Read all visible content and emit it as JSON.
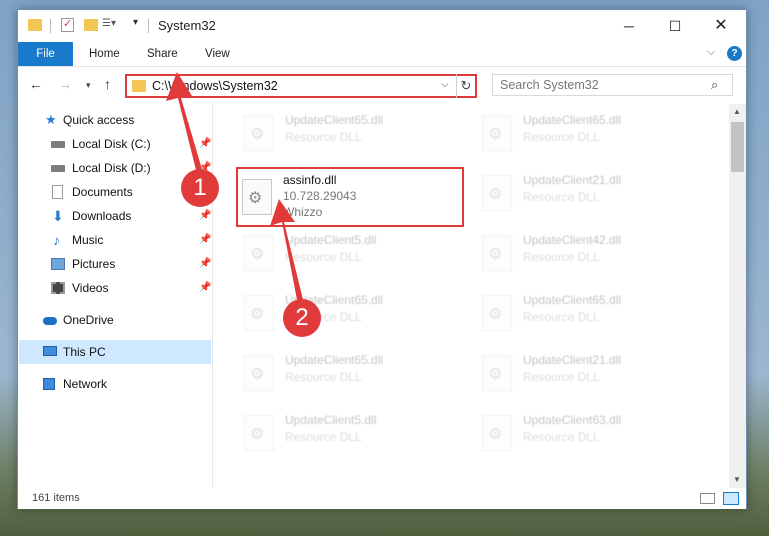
{
  "window": {
    "title": "System32",
    "controls": {
      "minimize": "─",
      "maximize": "☐",
      "close": "✕"
    }
  },
  "ribbon": {
    "tabs": [
      "File",
      "Home",
      "Share",
      "View"
    ]
  },
  "nav": {
    "address": "C:\\Windows\\System32",
    "search_placeholder": "Search System32"
  },
  "sidebar": {
    "items": [
      {
        "label": "Quick access",
        "icon": "star-icon",
        "pinned": false
      },
      {
        "label": "Local Disk (C:)",
        "icon": "disk-icon",
        "pinned": true
      },
      {
        "label": "Local Disk (D:)",
        "icon": "disk-icon",
        "pinned": true
      },
      {
        "label": "Documents",
        "icon": "documents-icon",
        "pinned": true
      },
      {
        "label": "Downloads",
        "icon": "downloads-icon",
        "pinned": true
      },
      {
        "label": "Music",
        "icon": "music-icon",
        "pinned": true
      },
      {
        "label": "Pictures",
        "icon": "pictures-icon",
        "pinned": true
      },
      {
        "label": "Videos",
        "icon": "videos-icon",
        "pinned": true
      },
      {
        "label": "OneDrive",
        "icon": "onedrive-icon",
        "pinned": false
      },
      {
        "label": "This PC",
        "icon": "this-pc-icon",
        "pinned": false,
        "selected": true
      },
      {
        "label": "Network",
        "icon": "network-icon",
        "pinned": false
      }
    ]
  },
  "files": {
    "left": [
      {
        "name": "UpdateClient65.dll",
        "line2": "Resource DLL"
      },
      {
        "name": "assinfo.dll",
        "line2": "10.728.29043",
        "line3": "Whizzo",
        "highlighted": true
      },
      {
        "name": "UpdateClient5.dll",
        "line2": "Resource DLL"
      },
      {
        "name": "UpdateClient65.dll",
        "line2": "Resource DLL"
      },
      {
        "name": "UpdateClient65.dll",
        "line2": "Resource DLL"
      },
      {
        "name": "UpdateClient5.dll",
        "line2": "Resource DLL"
      }
    ],
    "right": [
      {
        "name": "UpdateClient65.dll",
        "line2": "Resource DLL"
      },
      {
        "name": "UpdateClient21.dll",
        "line2": "Resource DLL"
      },
      {
        "name": "UpdateClient42.dll",
        "line2": "Resource DLL"
      },
      {
        "name": "UpdateClient65.dll",
        "line2": "Resource DLL"
      },
      {
        "name": "UpdateClient21.dll",
        "line2": "Resource DLL"
      },
      {
        "name": "UpdateClient63.dll",
        "line2": "Resource DLL"
      }
    ]
  },
  "status": {
    "item_count": "161 items"
  },
  "annotations": {
    "step1": "1",
    "step2": "2",
    "color": "#e03a3a"
  }
}
